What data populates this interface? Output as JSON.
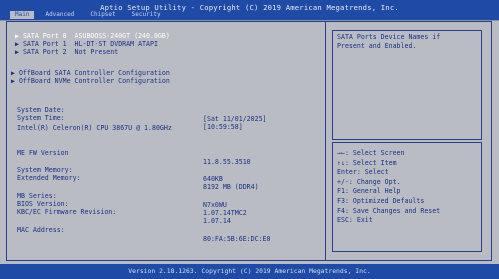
{
  "header": {
    "title": "Aptio Setup Utility - Copyright (C) 2019 American Megatrends, Inc.",
    "tabs": [
      {
        "label": "Main"
      },
      {
        "label": "Advanced"
      },
      {
        "label": "Chipset"
      },
      {
        "label": "Security"
      }
    ]
  },
  "sata": {
    "port0": "▶ SATA Port 0  ASUBOOSS-240GT (240.0GB)",
    "port1": "▶ SATA Port 1  HL-DT-ST DVDRAM ATAPI",
    "port2": "▶ SATA Port 2  Not Present"
  },
  "offboard": {
    "sata": "▶ OffBoard SATA Controller Configuration",
    "nvme": "▶ OffBoard NVMe Controller Configuration"
  },
  "system": {
    "date_label": "System Date:",
    "date_value": "[Sat 11/01/2025]",
    "time_label": "System Time:",
    "time_value": "[10:59:58]",
    "cpu": "Intel(R) Celeron(R) CPU 3867U @ 1.80GHz",
    "me_label": "ME FW Version",
    "me_value": "11.8.55.3510",
    "mem_label": "System Memory:",
    "mem_value": "640KB",
    "ext_label": "Extended Memory:",
    "ext_value": "8192 MB (DDR4)",
    "mb_label": "MB Series:",
    "mb_value": "N7x0WU",
    "bios_label": "BIOS Version:",
    "bios_value": "1.07.14TMC2",
    "kbc_label": "KBC/EC Firmware Revision:",
    "kbc_value": "1.07.14",
    "mac_label": "MAC Address:",
    "mac_value": "80:FA:5B:6E:DC:E0"
  },
  "help": {
    "text": "SATA Ports Device Names if\nPresent and Enabled."
  },
  "keys": [
    "→←: Select Screen",
    "↑↓: Select Item",
    "Enter: Select",
    "+/-: Change Opt.",
    "F1: General Help",
    "F3: Optimized Defaults",
    "F4: Save Changes and Reset",
    "ESC: Exit"
  ],
  "footer": {
    "text": "Version 2.18.1263. Copyright (C) 2019 American Megatrends, Inc."
  }
}
